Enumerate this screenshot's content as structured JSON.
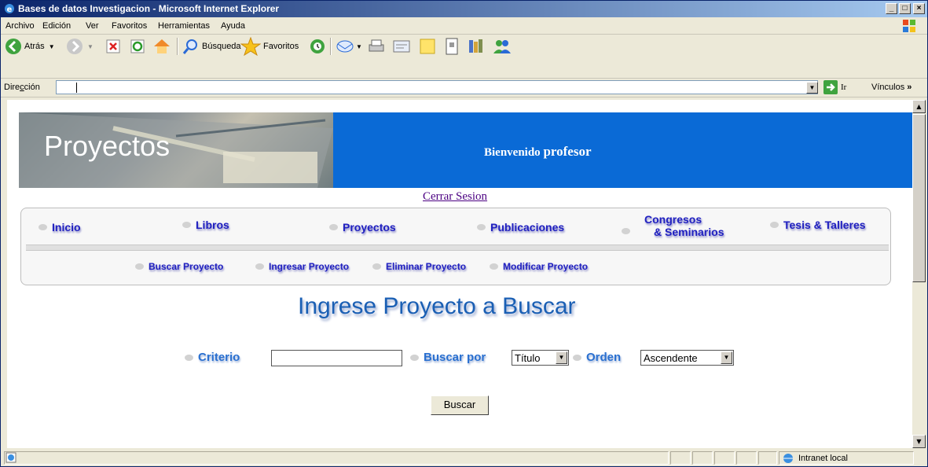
{
  "window": {
    "title": "Bases de datos Investigacion - Microsoft Internet Explorer"
  },
  "menu": [
    {
      "label": "Archivo"
    },
    {
      "label": "Edición"
    },
    {
      "label": "Ver"
    },
    {
      "label": "Favoritos"
    },
    {
      "label": "Herramientas"
    },
    {
      "label": "Ayuda"
    }
  ],
  "toolbar": {
    "back": "Atrás",
    "search": "Búsqueda",
    "favorites": "Favoritos"
  },
  "address": {
    "label": "Dirección",
    "value": "",
    "go": "Ir",
    "links": "Vínculos"
  },
  "banner": {
    "title": "Proyectos",
    "welcome": "Bienvenido",
    "user": "profesor"
  },
  "logout": "Cerrar Sesion",
  "nav": [
    "Inicio",
    "Libros",
    "Proyectos",
    "Publicaciones",
    "Congresos",
    "& Seminarios",
    "Tesis & Talleres"
  ],
  "subnav": [
    "Buscar Proyecto",
    "Ingresar Proyecto",
    "Eliminar Proyecto",
    "Modificar Proyecto"
  ],
  "heading": "Ingrese Proyecto a Buscar",
  "form": {
    "criterio_label": "Criterio",
    "criterio_value": "",
    "buscar_por_label": "Buscar por",
    "buscar_por_value": "Título",
    "orden_label": "Orden",
    "orden_value": "Ascendente",
    "submit": "Buscar"
  },
  "status": {
    "zone": "Intranet local"
  },
  "colors": {
    "banner": "#0a6ad6",
    "nav_text": "#2020c0",
    "form_label": "#2a70d0"
  }
}
